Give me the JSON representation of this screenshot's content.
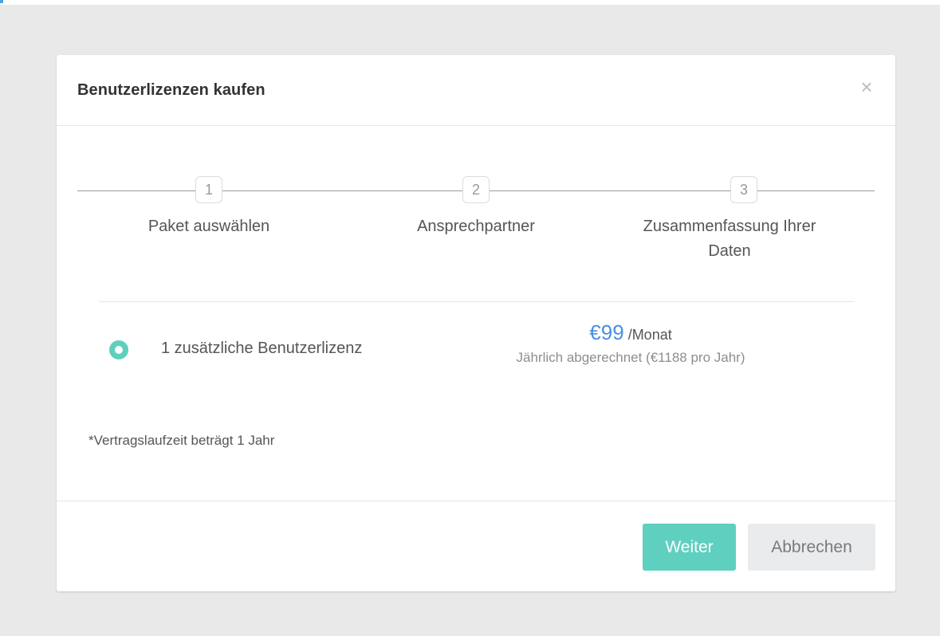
{
  "modal": {
    "title": "Benutzerlizenzen kaufen",
    "close_glyph": "×"
  },
  "stepper": {
    "steps": [
      {
        "number": "1",
        "label": "Paket auswählen"
      },
      {
        "number": "2",
        "label": "Ansprechpartner"
      },
      {
        "number": "3",
        "label": "Zusammenfassung Ihrer Daten"
      }
    ]
  },
  "package": {
    "selected": true,
    "label": "1 zusätzliche Benutzerlizenz",
    "price": "€99",
    "period": "/Monat",
    "billing_note": "Jährlich abgerechnet (€1188 pro Jahr)"
  },
  "contract_note": "*Vertragslaufzeit beträgt 1 Jahr",
  "footer": {
    "next_label": "Weiter",
    "cancel_label": "Abbrechen"
  },
  "colors": {
    "accent": "#5fcfc0",
    "price_blue": "#4a8fe0",
    "backdrop": "#e9e9e9"
  },
  "icons": {
    "close": "close-icon",
    "radio": "radio-selected-icon"
  }
}
